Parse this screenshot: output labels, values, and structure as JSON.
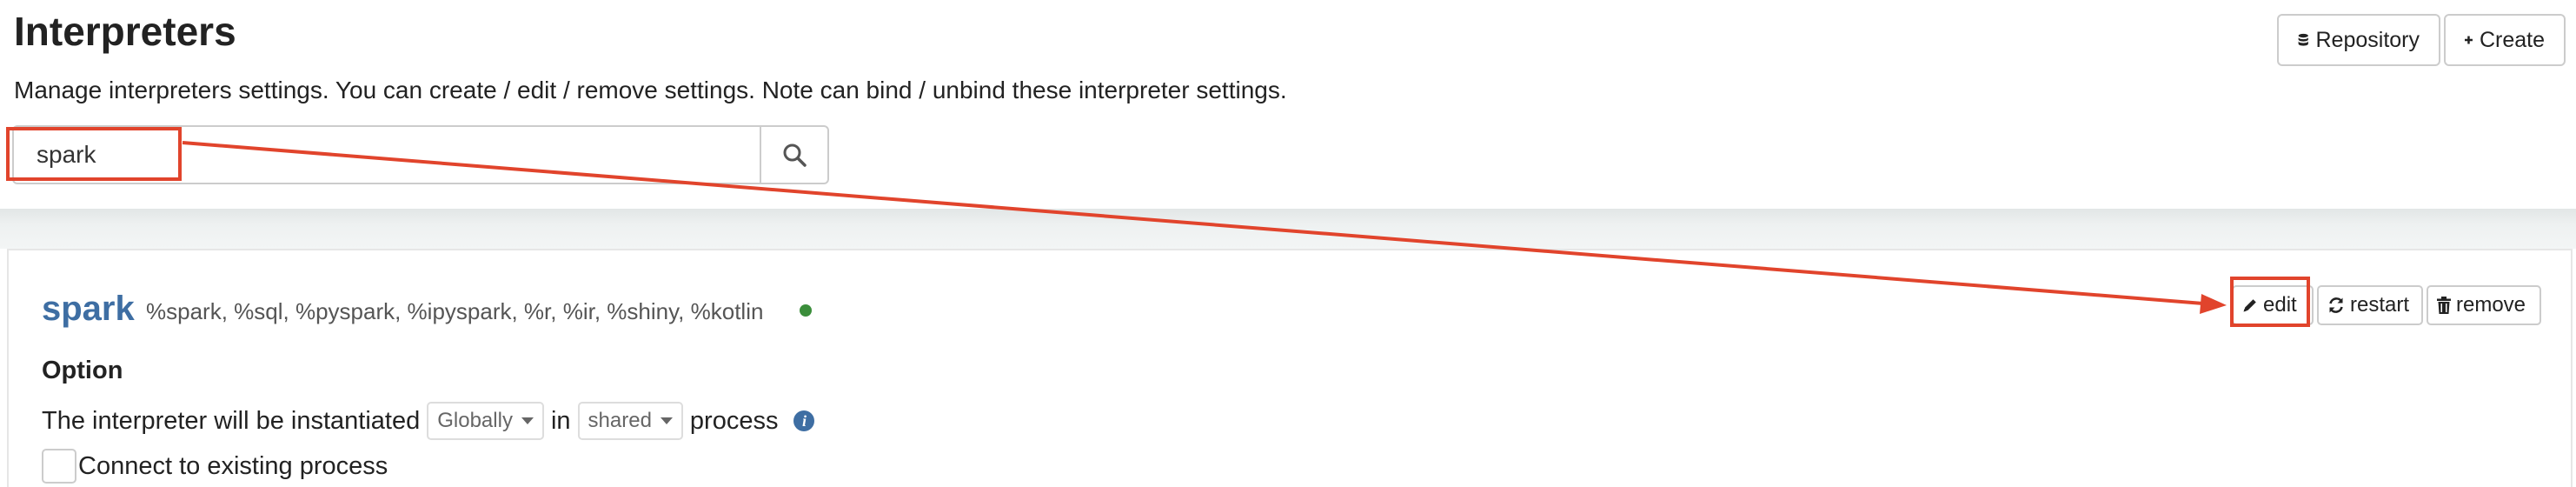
{
  "header": {
    "title": "Interpreters",
    "description": "Manage interpreters settings. You can create / edit / remove settings. Note can bind / unbind these interpreter settings.",
    "repository_label": "Repository",
    "create_label": "Create"
  },
  "search": {
    "value": "spark"
  },
  "interpreter": {
    "name": "spark",
    "bindings": "%spark, %sql, %pyspark, %ipyspark, %r, %ir, %shiny, %kotlin",
    "status_color": "#3b8e3b",
    "edit_label": "edit",
    "restart_label": "restart",
    "remove_label": "remove",
    "option_title": "Option",
    "instantiated_text": "The interpreter will be instantiated",
    "scope_selected": "Globally",
    "in_text": "in",
    "mode_selected": "shared",
    "process_text": "process",
    "connect_label": "Connect to existing process"
  },
  "annotations": {
    "color": "#e1442c"
  },
  "colors": {
    "link_blue": "#3e6ea3",
    "separator": "#e9eded"
  }
}
